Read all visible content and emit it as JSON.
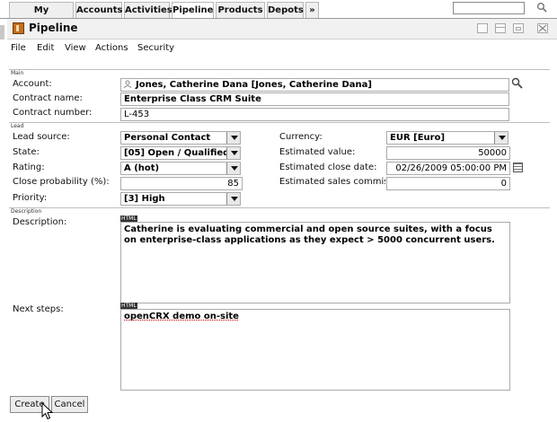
{
  "nav": {
    "tabs": [
      "My Homepage",
      "Accounts",
      "Activities",
      "Pipeline",
      "Products",
      "Depots",
      "»"
    ],
    "active_tab": "Pipeline",
    "search_value": ""
  },
  "window": {
    "title": "Pipeline"
  },
  "menu": [
    "File",
    "Edit",
    "View",
    "Actions",
    "Security"
  ],
  "sections": {
    "main": "Main",
    "lead": "Lead",
    "description": "Description"
  },
  "form": {
    "account_label": "Account:",
    "account_value": "Jones, Catherine Dana [Jones, Catherine Dana]",
    "contract_name_label": "Contract name:",
    "contract_name_value": "Enterprise Class CRM Suite",
    "contract_number_label": "Contract number:",
    "contract_number_value": "L-453",
    "lead_source_label": "Lead source:",
    "lead_source_value": "Personal Contact",
    "state_label": "State:",
    "state_value": "[05] Open / Qualified",
    "rating_label": "Rating:",
    "rating_value": "A (hot)",
    "close_prob_label": "Close probability (%):",
    "close_prob_value": "85",
    "priority_label": "Priority:",
    "priority_value": "[3] High",
    "currency_label": "Currency:",
    "currency_value": "EUR [Euro]",
    "est_value_label": "Estimated value:",
    "est_value_value": "50000",
    "est_close_label": "Estimated close date:",
    "est_close_value": "02/26/2009 05:00:00 PM",
    "est_commission_label": "Estimated sales commissi",
    "est_commission_value": "0",
    "description_label": "Description:",
    "description_value": "Catherine is evaluating commercial and open source suites, with a focus\non enterprise-class applications as they expect > 5000 concurrent users.",
    "next_steps_label": "Next steps:",
    "next_steps_value": "openCRX demo on-site",
    "html_tag": "HTML"
  },
  "buttons": {
    "create": "Create",
    "cancel": "Cancel"
  }
}
